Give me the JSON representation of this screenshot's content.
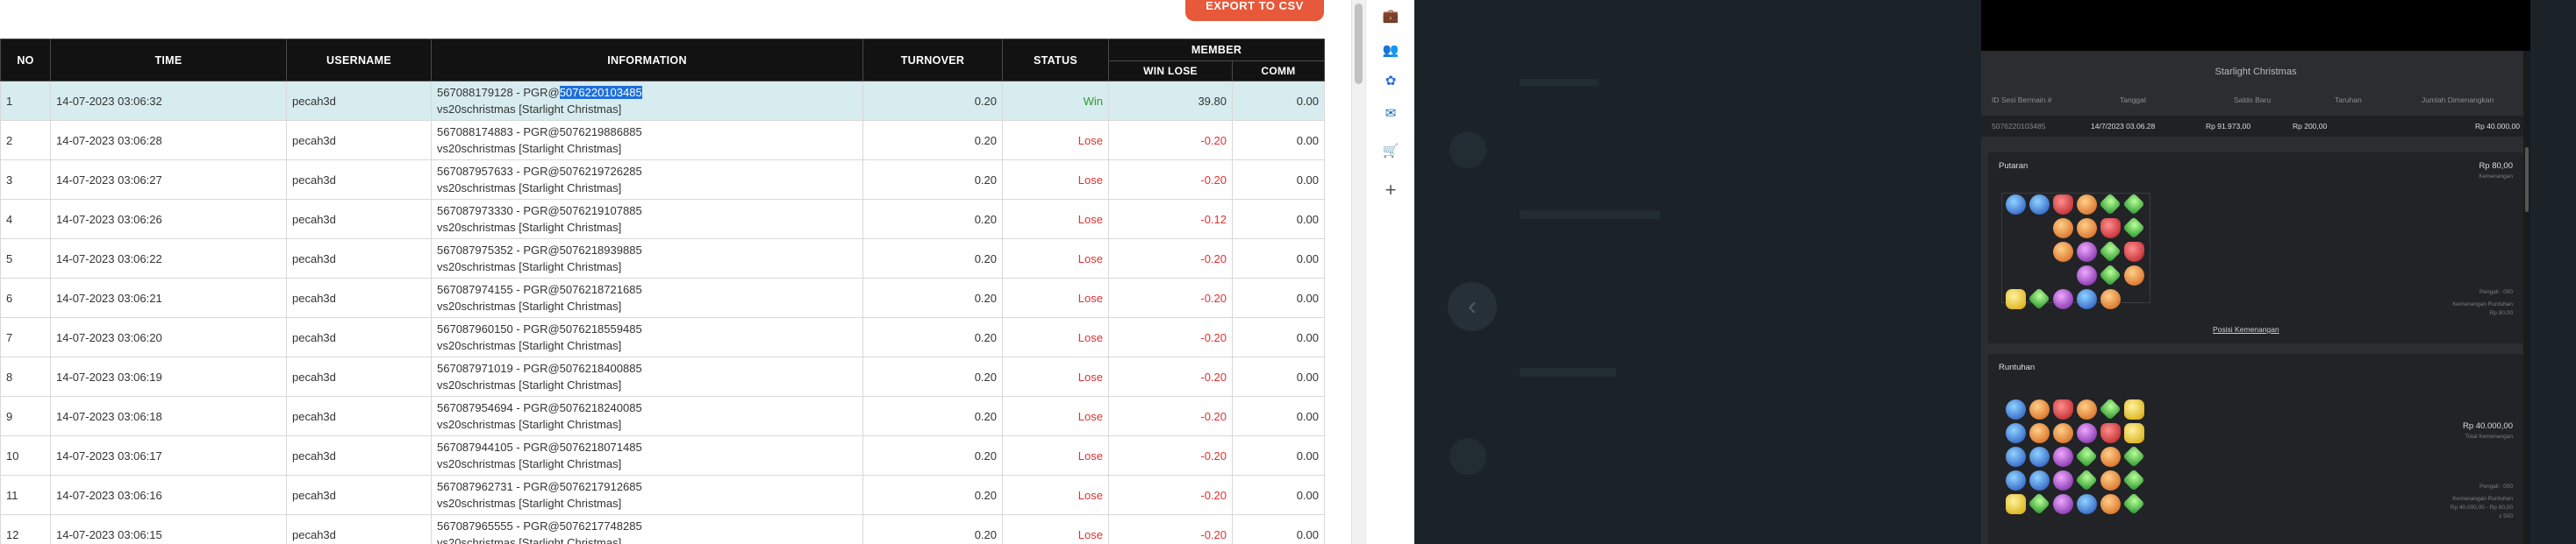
{
  "report": {
    "export_label": "EXPORT TO CSV",
    "headers": {
      "no": "NO",
      "time": "TIME",
      "username": "USERNAME",
      "information": "INFORMATION",
      "turnover": "TURNOVER",
      "status": "STATUS",
      "member": "MEMBER",
      "win_lose": "WIN LOSE",
      "comm": "COMM"
    },
    "rows": [
      {
        "no": "1",
        "time": "14-07-2023 03:06:32",
        "user": "pecah3d",
        "info_a": "567088179128 - PGR@",
        "info_hl": "5076220103485",
        "info_b": "vs20schristmas [Starlight Christmas]",
        "turnover": "0.20",
        "status": "Win",
        "winlose": "39.80",
        "comm": "0.00"
      },
      {
        "no": "2",
        "time": "14-07-2023 03:06:28",
        "user": "pecah3d",
        "info_a": "567088174883 - PGR@5076219886885",
        "info_hl": "",
        "info_b": "vs20schristmas [Starlight Christmas]",
        "turnover": "0.20",
        "status": "Lose",
        "winlose": "-0.20",
        "comm": "0.00"
      },
      {
        "no": "3",
        "time": "14-07-2023 03:06:27",
        "user": "pecah3d",
        "info_a": "567087957633 - PGR@5076219726285",
        "info_hl": "",
        "info_b": "vs20schristmas [Starlight Christmas]",
        "turnover": "0.20",
        "status": "Lose",
        "winlose": "-0.20",
        "comm": "0.00"
      },
      {
        "no": "4",
        "time": "14-07-2023 03:06:26",
        "user": "pecah3d",
        "info_a": "567087973330 - PGR@5076219107885",
        "info_hl": "",
        "info_b": "vs20schristmas [Starlight Christmas]",
        "turnover": "0.20",
        "status": "Lose",
        "winlose": "-0.12",
        "comm": "0.00"
      },
      {
        "no": "5",
        "time": "14-07-2023 03:06:22",
        "user": "pecah3d",
        "info_a": "567087975352 - PGR@5076218939885",
        "info_hl": "",
        "info_b": "vs20schristmas [Starlight Christmas]",
        "turnover": "0.20",
        "status": "Lose",
        "winlose": "-0.20",
        "comm": "0.00"
      },
      {
        "no": "6",
        "time": "14-07-2023 03:06:21",
        "user": "pecah3d",
        "info_a": "567087974155 - PGR@5076218721685",
        "info_hl": "",
        "info_b": "vs20schristmas [Starlight Christmas]",
        "turnover": "0.20",
        "status": "Lose",
        "winlose": "-0.20",
        "comm": "0.00"
      },
      {
        "no": "7",
        "time": "14-07-2023 03:06:20",
        "user": "pecah3d",
        "info_a": "567087960150 - PGR@5076218559485",
        "info_hl": "",
        "info_b": "vs20schristmas [Starlight Christmas]",
        "turnover": "0.20",
        "status": "Lose",
        "winlose": "-0.20",
        "comm": "0.00"
      },
      {
        "no": "8",
        "time": "14-07-2023 03:06:19",
        "user": "pecah3d",
        "info_a": "567087971019 - PGR@5076218400885",
        "info_hl": "",
        "info_b": "vs20schristmas [Starlight Christmas]",
        "turnover": "0.20",
        "status": "Lose",
        "winlose": "-0.20",
        "comm": "0.00"
      },
      {
        "no": "9",
        "time": "14-07-2023 03:06:18",
        "user": "pecah3d",
        "info_a": "567087954694 - PGR@5076218240085",
        "info_hl": "",
        "info_b": "vs20schristmas [Starlight Christmas]",
        "turnover": "0.20",
        "status": "Lose",
        "winlose": "-0.20",
        "comm": "0.00"
      },
      {
        "no": "10",
        "time": "14-07-2023 03:06:17",
        "user": "pecah3d",
        "info_a": "567087944105 - PGR@5076218071485",
        "info_hl": "",
        "info_b": "vs20schristmas [Starlight Christmas]",
        "turnover": "0.20",
        "status": "Lose",
        "winlose": "-0.20",
        "comm": "0.00"
      },
      {
        "no": "11",
        "time": "14-07-2023 03:06:16",
        "user": "pecah3d",
        "info_a": "567087962731 - PGR@5076217912685",
        "info_hl": "",
        "info_b": "vs20schristmas [Starlight Christmas]",
        "turnover": "0.20",
        "status": "Lose",
        "winlose": "-0.20",
        "comm": "0.00"
      },
      {
        "no": "12",
        "time": "14-07-2023 03:06:15",
        "user": "pecah3d",
        "info_a": "567087965555 - PGR@5076217748285",
        "info_hl": "",
        "info_b": "vs20schristmas [Starlight Christmas]",
        "turnover": "0.20",
        "status": "Lose",
        "winlose": "-0.20",
        "comm": "0.00"
      }
    ]
  },
  "rail_icons": [
    "briefcase-icon",
    "people-icon",
    "copilot-icon",
    "outlook-icon",
    "shopping-icon",
    "plus-icon"
  ],
  "game_history": {
    "title": "Starlight Christmas",
    "columns": {
      "id": "ID Sesi Bermain #",
      "date": "Tanggal",
      "balance": "Saldo Baru",
      "bet": "Taruhan",
      "winnings": "Jumlah Dimenangkan"
    },
    "record": {
      "id": "5076220103485",
      "date": "14/7/2023 03.06.28",
      "balance": "Rp 91.973,00",
      "bet": "Rp 200,00",
      "winnings": "Rp 40.000,00"
    },
    "spin": {
      "title": "Putaran",
      "amount": "Rp 80,00",
      "amount_sub": "Kemenangan",
      "pengali": "Pengali : 000",
      "cascade_label": "Kemenangan Runtuhan",
      "cascade_value": "Rp 80,00",
      "link": "Posisi Kemenangan"
    },
    "tumble": {
      "title": "Runtuhan",
      "amount": "Rp 40.000,00",
      "amount_sub": "Total Kemenangan",
      "pengali": "Pengali : 000",
      "cascade_label": "Kemenangan Runtuhan",
      "cascade_value": "Rp 40.000,00 - Rp 80,00",
      "extra": "x 500"
    }
  }
}
